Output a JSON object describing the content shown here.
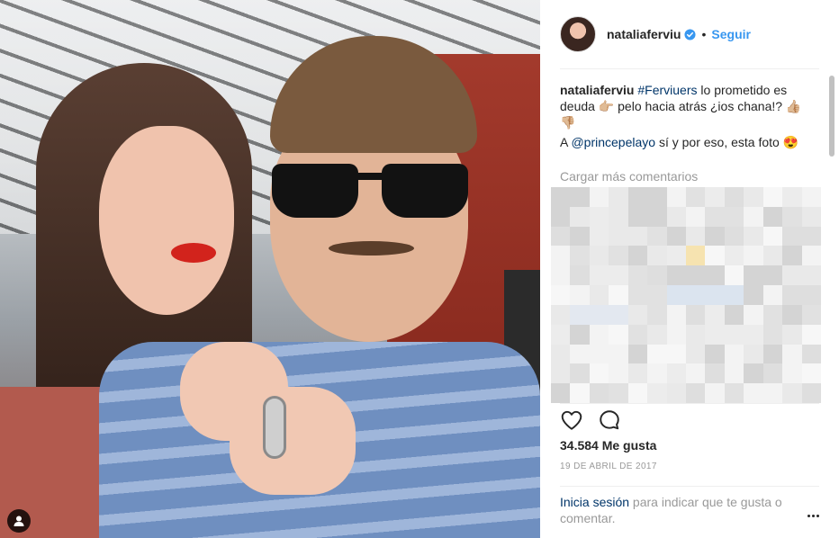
{
  "post": {
    "username": "nataliaferviu",
    "verified": true,
    "separator": "•",
    "follow_label": "Seguir"
  },
  "caption": {
    "username": "nataliaferviu",
    "hashtag": "#Ferviuers",
    "line1_rest": " lo prometido es deuda 👉🏼 pelo hacia atrás ¿ios chana!? 👍🏼👎🏼",
    "line2_prefix": "A ",
    "mention": "@princepelayo",
    "line2_rest": " sí y por eso, esta foto 😍"
  },
  "comments": {
    "load_more_label": "Cargar más comentarios"
  },
  "engagement": {
    "likes_text": "34.584 Me gusta",
    "date_text": "19 DE ABRIL DE 2017"
  },
  "login_prompt": {
    "link_text": "Inicia sesión",
    "rest_text": " para indicar que te gusta o comentar."
  },
  "icons": {
    "like": "heart-icon",
    "comment": "comment-icon",
    "options": "more-options-icon",
    "tag": "user-tag-icon",
    "verified": "verified-badge-icon"
  },
  "colors": {
    "link_blue": "#3897f0",
    "dark_link": "#003569",
    "muted": "#999999",
    "text": "#262626"
  }
}
